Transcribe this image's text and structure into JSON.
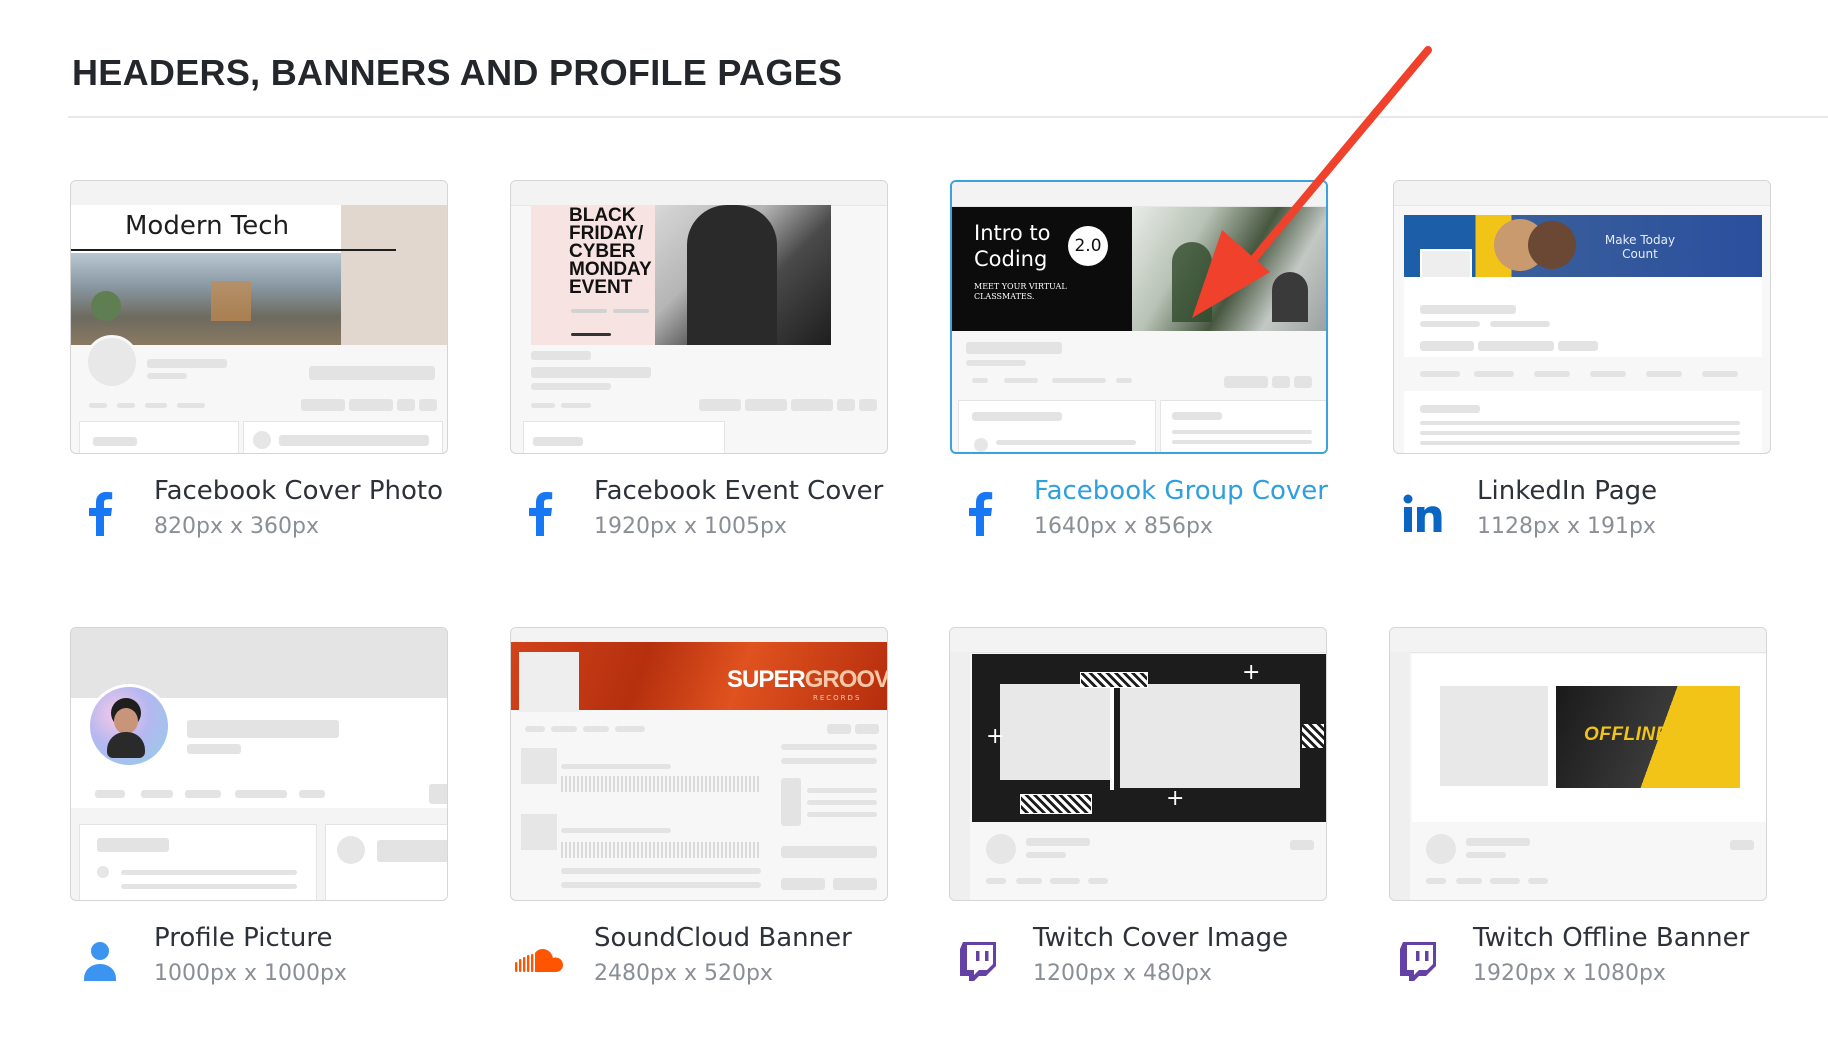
{
  "section": {
    "title": "HEADERS, BANNERS AND PROFILE PAGES"
  },
  "cards": [
    {
      "title": "Facebook Cover Photo",
      "size": "820px x 360px",
      "icon": "facebook-icon",
      "preview": {
        "headline": "Modern Tech"
      }
    },
    {
      "title": "Facebook Event Cover",
      "size": "1920px x 1005px",
      "icon": "facebook-icon",
      "preview": {
        "headline": "BLACK FRIDAY/ CYBER MONDAY EVENT",
        "line1": "BLACK",
        "line2": "FRIDAY/",
        "line3": "CYBER",
        "line4": "MONDAY",
        "line5": "EVENT"
      }
    },
    {
      "title": "Facebook Group Cover",
      "size": "1640px x 856px",
      "icon": "facebook-icon",
      "preview": {
        "headline_line1": "Intro to",
        "headline_line2": "Coding",
        "badge": "2.0",
        "subline1": "MEET YOUR VIRTUAL",
        "subline2": "CLASSMATES."
      }
    },
    {
      "title": "LinkedIn Page",
      "size": "1128px x 191px",
      "icon": "linkedin-icon",
      "preview": {
        "tagline_line1": "Make Today",
        "tagline_line2": "Count"
      }
    },
    {
      "title": "Profile Picture",
      "size": "1000px x 1000px",
      "icon": "user-icon"
    },
    {
      "title": "SoundCloud Banner",
      "size": "2480px x 520px",
      "icon": "soundcloud-icon",
      "preview": {
        "brand_a": "SUPER",
        "brand_b": "GROOVE",
        "brand_sub": "RECORDS"
      }
    },
    {
      "title": "Twitch Cover Image",
      "size": "1200px x 480px",
      "icon": "twitch-icon"
    },
    {
      "title": "Twitch Offline Banner",
      "size": "1920px x 1080px",
      "icon": "twitch-icon",
      "preview": {
        "label": "OFFLINE"
      }
    }
  ],
  "colors": {
    "facebook": "#1877f2",
    "linkedin": "#0a66c2",
    "twitch": "#6441a5",
    "soundcloud": "#ff5500",
    "active_link": "#2f9fe0",
    "arrow": "#f0412c"
  }
}
